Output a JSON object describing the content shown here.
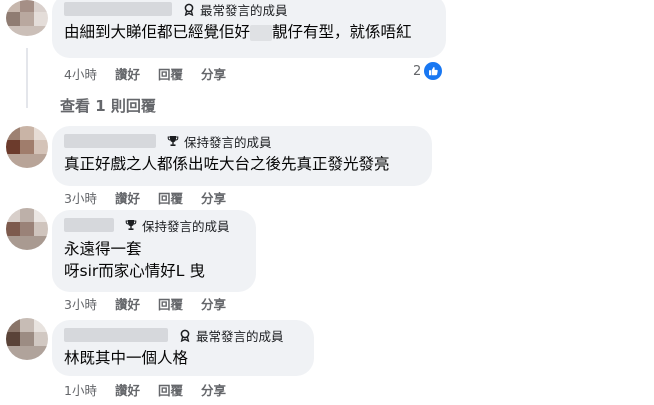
{
  "comments": [
    {
      "badge": "最常發言的成員",
      "badge_icon": "top-fan-icon",
      "lines": [
        "由細到大睇佢都已經覺佢好",
        "靚仔有型，就係唔紅"
      ],
      "time": "4小時",
      "like": "讚好",
      "reply": "回覆",
      "share": "分享",
      "reaction_count": "2",
      "reaction_icon": "like-icon"
    },
    {
      "badge": "保持發言的成員",
      "badge_icon": "trophy-icon",
      "lines": [
        "真正好戲之人都係出咗大台之後先真正發光發亮"
      ],
      "time": "3小時",
      "like": "讚好",
      "reply": "回覆",
      "share": "分享"
    },
    {
      "badge": "保持發言的成員",
      "badge_icon": "trophy-icon",
      "lines": [
        "永遠得一套",
        "呀sir而家心情好L 曳"
      ],
      "time": "3小時",
      "like": "讚好",
      "reply": "回覆",
      "share": "分享"
    },
    {
      "badge": "最常發言的成員",
      "badge_icon": "top-fan-icon",
      "lines": [
        "林既其中一個人格"
      ],
      "time": "1小時",
      "like": "讚好",
      "reply": "回覆",
      "share": "分享"
    }
  ],
  "view_replies": "查看 1 則回覆",
  "colors": {
    "bubble": "#f0f2f5",
    "meta": "#65676b",
    "like_blue": "#1877f2"
  }
}
